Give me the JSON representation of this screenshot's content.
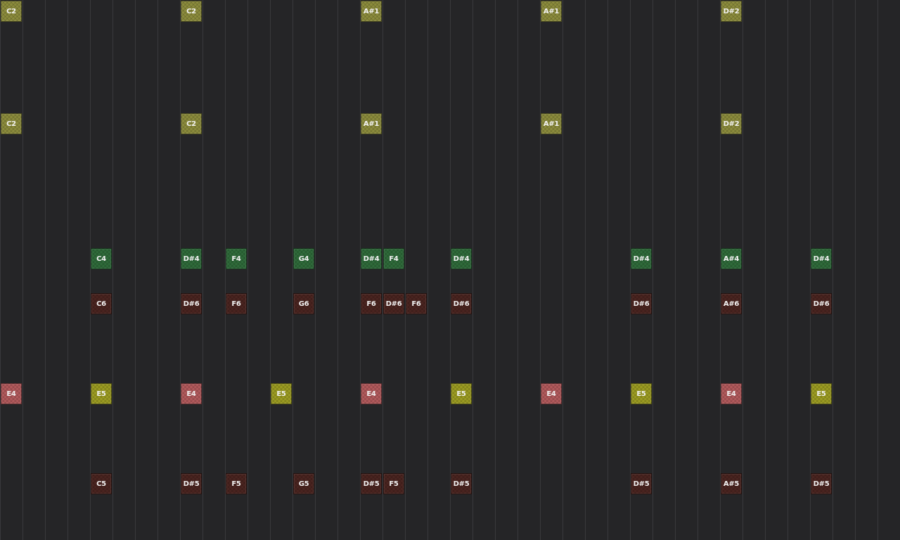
{
  "palette": {
    "olive": "#8c8c3c",
    "green": "#2f6b3a",
    "maroon": "#4a2420",
    "pink": "#b25a5c",
    "yellow": "#9c9c22"
  },
  "rows": [
    {
      "track": "olive",
      "notes": [
        {
          "step": 0,
          "label": "C2"
        },
        {
          "step": 8,
          "label": "C2"
        },
        {
          "step": 16,
          "label": "A#1"
        },
        {
          "step": 24,
          "label": "A#1"
        },
        {
          "step": 32,
          "label": "D#2"
        }
      ]
    },
    {
      "track": "olive",
      "notes": [
        {
          "step": 0,
          "label": "C2"
        },
        {
          "step": 8,
          "label": "C2"
        },
        {
          "step": 16,
          "label": "A#1"
        },
        {
          "step": 24,
          "label": "A#1"
        },
        {
          "step": 32,
          "label": "D#2"
        }
      ]
    },
    {
      "track": "green",
      "notes": [
        {
          "step": 4,
          "label": "C4"
        },
        {
          "step": 8,
          "label": "D#4"
        },
        {
          "step": 10,
          "label": "F4"
        },
        {
          "step": 13,
          "label": "G4"
        },
        {
          "step": 16,
          "label": "D#4"
        },
        {
          "step": 17,
          "label": "F4"
        },
        {
          "step": 20,
          "label": "D#4"
        },
        {
          "step": 28,
          "label": "D#4"
        },
        {
          "step": 32,
          "label": "A#4"
        },
        {
          "step": 36,
          "label": "D#4"
        }
      ]
    },
    {
      "track": "maroon",
      "notes": [
        {
          "step": 4,
          "label": "C6"
        },
        {
          "step": 8,
          "label": "D#6"
        },
        {
          "step": 10,
          "label": "F6"
        },
        {
          "step": 13,
          "label": "G6"
        },
        {
          "step": 16,
          "label": "F6"
        },
        {
          "step": 17,
          "label": "D#6"
        },
        {
          "step": 18,
          "label": "F6"
        },
        {
          "step": 20,
          "label": "D#6"
        },
        {
          "step": 28,
          "label": "D#6"
        },
        {
          "step": 32,
          "label": "A#6"
        },
        {
          "step": 36,
          "label": "D#6"
        }
      ]
    },
    {
      "track": "mixed",
      "notes": [
        {
          "step": 0,
          "label": "E4",
          "color": "pink"
        },
        {
          "step": 4,
          "label": "E5",
          "color": "yellow"
        },
        {
          "step": 8,
          "label": "E4",
          "color": "pink"
        },
        {
          "step": 12,
          "label": "E5",
          "color": "yellow"
        },
        {
          "step": 16,
          "label": "E4",
          "color": "pink"
        },
        {
          "step": 20,
          "label": "E5",
          "color": "yellow"
        },
        {
          "step": 24,
          "label": "E4",
          "color": "pink"
        },
        {
          "step": 28,
          "label": "E5",
          "color": "yellow"
        },
        {
          "step": 32,
          "label": "E4",
          "color": "pink"
        },
        {
          "step": 36,
          "label": "E5",
          "color": "yellow"
        }
      ]
    },
    {
      "track": "maroon",
      "notes": [
        {
          "step": 4,
          "label": "C5"
        },
        {
          "step": 8,
          "label": "D#5"
        },
        {
          "step": 10,
          "label": "F5"
        },
        {
          "step": 13,
          "label": "G5"
        },
        {
          "step": 16,
          "label": "D#5"
        },
        {
          "step": 17,
          "label": "F5"
        },
        {
          "step": 20,
          "label": "D#5"
        },
        {
          "step": 28,
          "label": "D#5"
        },
        {
          "step": 32,
          "label": "A#5"
        },
        {
          "step": 36,
          "label": "D#5"
        }
      ]
    }
  ]
}
